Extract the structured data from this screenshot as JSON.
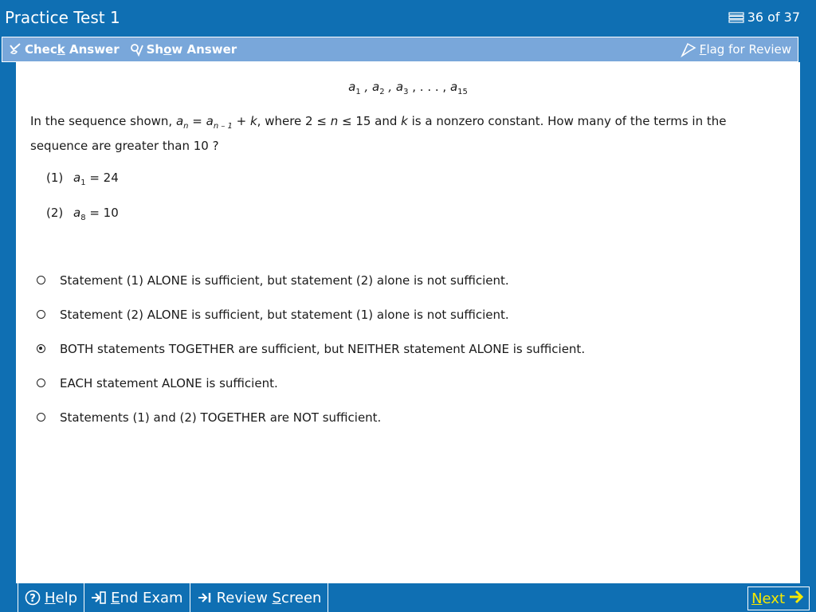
{
  "header": {
    "title": "Practice Test 1",
    "progress": "36 of 37"
  },
  "toolbar": {
    "check_pre": "Chec",
    "check_acc": "k",
    "check_post": " Answer",
    "show_pre": "Sh",
    "show_acc": "o",
    "show_post": "w Answer",
    "flag_acc": "F",
    "flag_post": "lag for Review"
  },
  "question": {
    "sequence": {
      "t1": "a",
      "s1": "1",
      "t2": "a",
      "s2": "2",
      "t3": "a",
      "s3": "3",
      "dots": ", . . . ,",
      "t4": "a",
      "s4": "15"
    },
    "stem": {
      "p1": "In the sequence shown, ",
      "an": "a",
      "an_sub": "n",
      "eq": " = ",
      "an1": "a",
      "an1_sub": "n – 1",
      "plus": " + ",
      "k": "k",
      "p2": ", where 2  ≤ ",
      "n": "n",
      "p3": "  ≤ 15 and ",
      "k2": "k",
      "p4": " is a nonzero constant.  How many of the terms in the sequence are greater than 10 ?"
    },
    "statements": [
      {
        "num": "(1)",
        "var": "a",
        "sub": "1",
        "rest": " = 24"
      },
      {
        "num": "(2)",
        "var": "a",
        "sub": "8",
        "rest": " = 10"
      }
    ]
  },
  "choices": [
    {
      "text": "Statement (1) ALONE is sufficient, but statement (2) alone is not sufficient.",
      "selected": false
    },
    {
      "text": "Statement (2) ALONE is sufficient, but statement (1) alone is not sufficient.",
      "selected": false
    },
    {
      "text": "BOTH statements TOGETHER are sufficient, but NEITHER statement ALONE is sufficient.",
      "selected": true
    },
    {
      "text": "EACH statement ALONE is sufficient.",
      "selected": false
    },
    {
      "text": "Statements (1) and (2) TOGETHER are NOT sufficient.",
      "selected": false
    }
  ],
  "bottom": {
    "help_acc": "H",
    "help_post": "elp",
    "end_acc": "E",
    "end_post": "nd Exam",
    "review_pre": "Review ",
    "review_acc": "S",
    "review_post": "creen",
    "next_acc": "N",
    "next_post": "ext"
  },
  "colors": {
    "frame": "#0f6fb3",
    "toolbar": "#79a7da",
    "next_text": "#f5e800"
  }
}
